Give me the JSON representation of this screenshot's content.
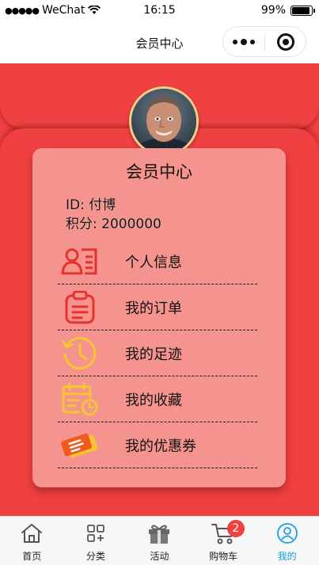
{
  "status_bar": {
    "carrier": "WeChat",
    "time": "16:15",
    "battery": "99%",
    "battery_level": 0.99
  },
  "nav": {
    "title": "会员中心"
  },
  "profile": {
    "card_title": "会员中心",
    "id_text": "ID: 付博",
    "points_text": "积分: 2000000"
  },
  "menu": [
    {
      "label": "个人信息",
      "icon": "id-card-icon"
    },
    {
      "label": "我的订单",
      "icon": "clipboard-icon"
    },
    {
      "label": "我的足迹",
      "icon": "history-clock-icon"
    },
    {
      "label": "我的收藏",
      "icon": "calendar-clock-icon"
    },
    {
      "label": "我的优惠券",
      "icon": "ticket-icon"
    }
  ],
  "tabs": [
    {
      "label": "首页",
      "icon": "home-icon"
    },
    {
      "label": "分类",
      "icon": "grid-icon"
    },
    {
      "label": "活动",
      "icon": "gift-icon"
    },
    {
      "label": "购物车",
      "icon": "cart-icon",
      "badge": "2"
    },
    {
      "label": "我的",
      "icon": "user-icon",
      "active": true
    }
  ],
  "colors": {
    "primary_red": "#ef4141",
    "card_pink": "#f5948f",
    "active_tab": "#1a9ee0",
    "icon_red": "#e5322d",
    "icon_yellow": "#f7c531"
  }
}
